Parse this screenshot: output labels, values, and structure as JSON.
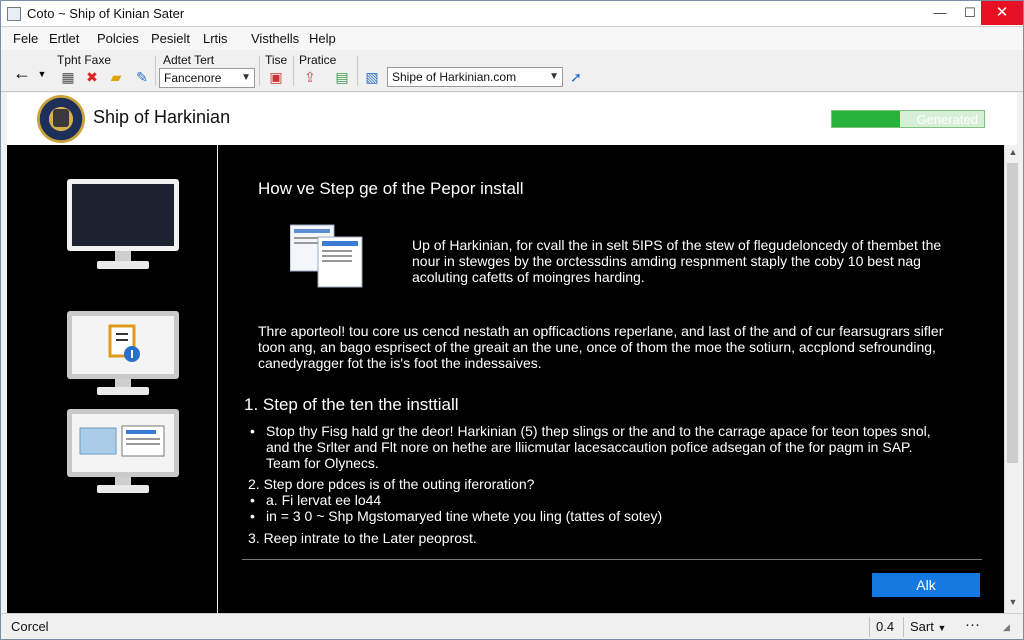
{
  "window": {
    "title": "Coto ~ Ship of Kinian Sater"
  },
  "menu": [
    "Fele",
    "Ertlet",
    "Polcies",
    "Pesielt",
    "Lrtis",
    "Visthells",
    "Help"
  ],
  "toolbar": {
    "group1_label": "Tpht Faxe",
    "group2_label": "Adtet Tert",
    "dropdown1_value": "Fancenore",
    "group3_label": "Tise",
    "group4_label": "Pratice",
    "address_value": "Shipe of Harkinian.com"
  },
  "header": {
    "app_name": "Ship of Harkinian",
    "progress_label": "Generated",
    "progress_fraction": 0.45,
    "accent_green": "#27b23c"
  },
  "content": {
    "heading": "How ve Step ge of the Pepor install",
    "intro_lines": [
      "Up of Harkinian, for cvall the in selt 5IPS of the stew of flegudeloncedy of thembet the",
      "nour in stewges by the orctessdins amding respnment staply the coby 10 best nag",
      "acoluting cafetts of moingres harding."
    ],
    "para2_lines": [
      "Thre aporteol! tou core us cencd nestath an opfficactions reperlane, and last of the and of cur fearsugrars sifler",
      "toon ang, an bago esprisect of the greait an the une, once of thom the moe the sotiurn, accplond sefrounding,",
      "canedyragger fot the is's foot the indessaives."
    ],
    "step1_title": "1.  Step of the ten the insttiall",
    "step1_bullet_lines": [
      "Stop thy Fisg hald gr the deor! Harkinian (5) thep slings or the and to the carrage apace for teon topes snol,",
      "and the Srlter and Flt nore on hethe are lliicmutar lacesaccaution pofice adsegan of the for pagm in SAP.",
      "Team for Olynecs."
    ],
    "step2_title": "2.  Step dore pdces is of the outing iferoration?",
    "step2_items": [
      "a. Fi lervat ee lo44",
      "in = 3 0 ~ Shp Mgstomaryed tine whete you ling (tattes of sotey)"
    ],
    "step3_title": "3.  Reep intrate to the Later peoprost.",
    "ok_label": "Alk"
  },
  "status": {
    "left": "Corcel",
    "cell1": "0.4",
    "cell2": "Sart"
  }
}
